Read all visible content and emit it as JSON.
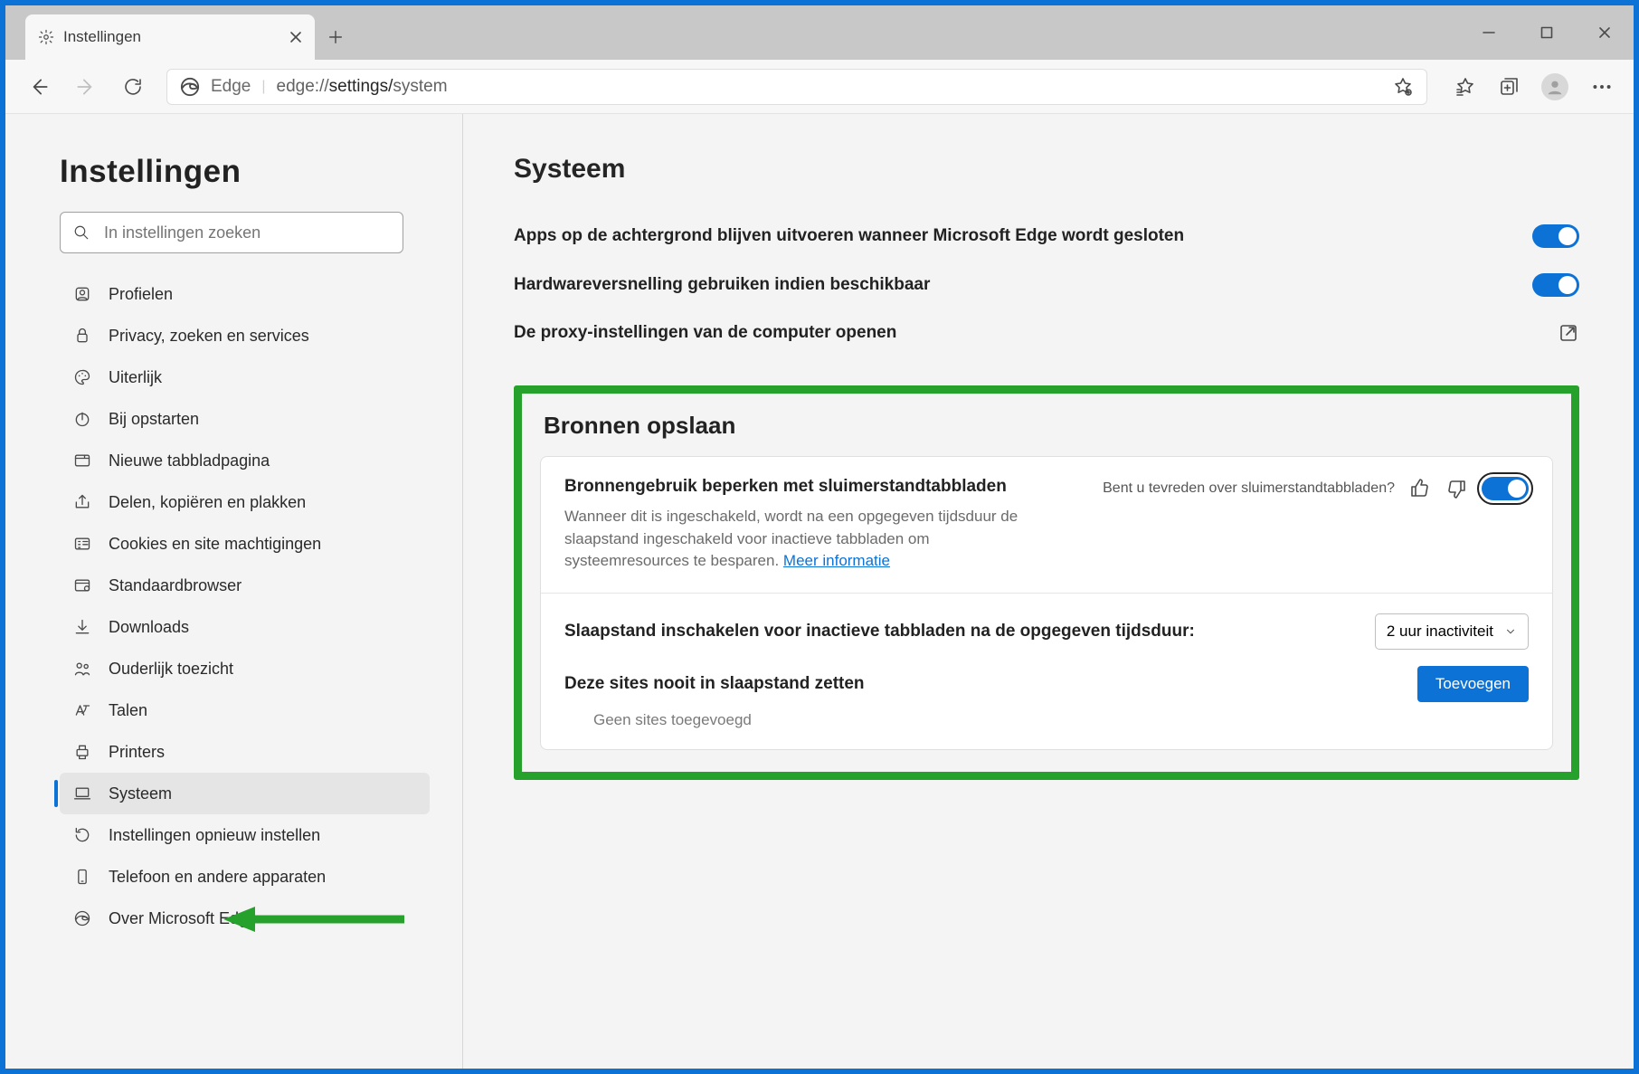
{
  "tab": {
    "title": "Instellingen"
  },
  "url": {
    "brand": "Edge",
    "prefix": "edge://",
    "middle": "settings/",
    "last": "system"
  },
  "sidebar": {
    "heading": "Instellingen",
    "search_placeholder": "In instellingen zoeken",
    "items": [
      {
        "label": "Profielen"
      },
      {
        "label": "Privacy, zoeken en services"
      },
      {
        "label": "Uiterlijk"
      },
      {
        "label": "Bij opstarten"
      },
      {
        "label": "Nieuwe tabbladpagina"
      },
      {
        "label": "Delen, kopiëren en plakken"
      },
      {
        "label": "Cookies en site machtigingen"
      },
      {
        "label": "Standaardbrowser"
      },
      {
        "label": "Downloads"
      },
      {
        "label": "Ouderlijk toezicht"
      },
      {
        "label": "Talen"
      },
      {
        "label": "Printers"
      },
      {
        "label": "Systeem"
      },
      {
        "label": "Instellingen opnieuw instellen"
      },
      {
        "label": "Telefoon en andere apparaten"
      },
      {
        "label": "Over Microsoft Edge"
      }
    ]
  },
  "main": {
    "heading": "Systeem",
    "rows": [
      {
        "label": "Apps op de achtergrond blijven uitvoeren wanneer Microsoft Edge wordt gesloten"
      },
      {
        "label": "Hardwareversnelling gebruiken indien beschikbaar"
      },
      {
        "label": "De proxy-instellingen van de computer openen"
      }
    ],
    "save": {
      "heading": "Bronnen opslaan",
      "sleep_title": "Bronnengebruik beperken met sluimerstandtabbladen",
      "sleep_desc": "Wanneer dit is ingeschakeld, wordt na een opgegeven tijdsduur de slaapstand ingeschakeld voor inactieve tabbladen om systeemresources te besparen.",
      "sleep_more": "Meer informatie",
      "feedback_prompt": "Bent u tevreden over sluimerstandtabbladen?",
      "duration_label": "Slaapstand inschakelen voor inactieve tabbladen na de opgegeven tijdsduur:",
      "duration_value": "2 uur inactiviteit",
      "never_sleep_label": "Deze sites nooit in slaapstand zetten",
      "add_button": "Toevoegen",
      "empty_text": "Geen sites toegevoegd"
    }
  }
}
